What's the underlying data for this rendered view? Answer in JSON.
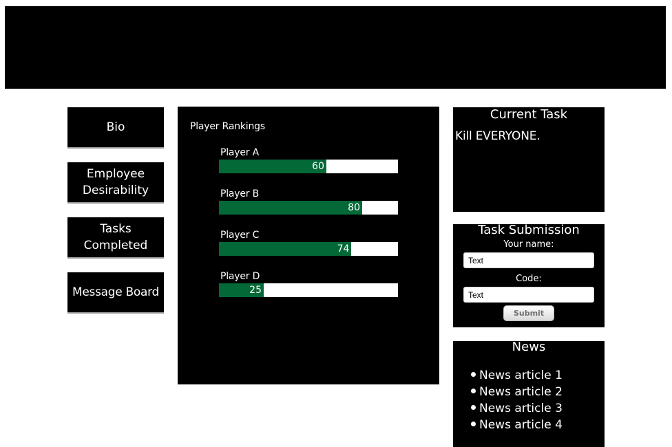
{
  "header": {
    "color": "#000000"
  },
  "sidebar": {
    "items": [
      {
        "lines": [
          "Bio"
        ]
      },
      {
        "lines": [
          "Employee",
          "Desirability"
        ]
      },
      {
        "lines": [
          "Tasks",
          "Completed"
        ]
      },
      {
        "lines": [
          "Message Board"
        ]
      }
    ]
  },
  "rankings": {
    "title": "Player Rankings",
    "bar_color": "#036937",
    "max": 100,
    "players": [
      {
        "name": "Player A",
        "score": 60,
        "label": "60"
      },
      {
        "name": "Player B",
        "score": 80,
        "label": "80"
      },
      {
        "name": "Player C",
        "score": 74,
        "label": "74"
      },
      {
        "name": "Player D",
        "score": 25,
        "label": "25"
      }
    ]
  },
  "current_task": {
    "title": "Current Task",
    "text": "Kill EVERYONE."
  },
  "task_submission": {
    "title": "Task Submission",
    "name_label": "Your name:",
    "name_value": "Text",
    "code_label": "Code:",
    "code_value": "Text",
    "submit_label": "Submit"
  },
  "news": {
    "title": "News",
    "bullet_icon": "bullet-icon",
    "items": [
      "News article 1",
      "News article 2",
      "News article 3",
      "News article 4"
    ]
  }
}
